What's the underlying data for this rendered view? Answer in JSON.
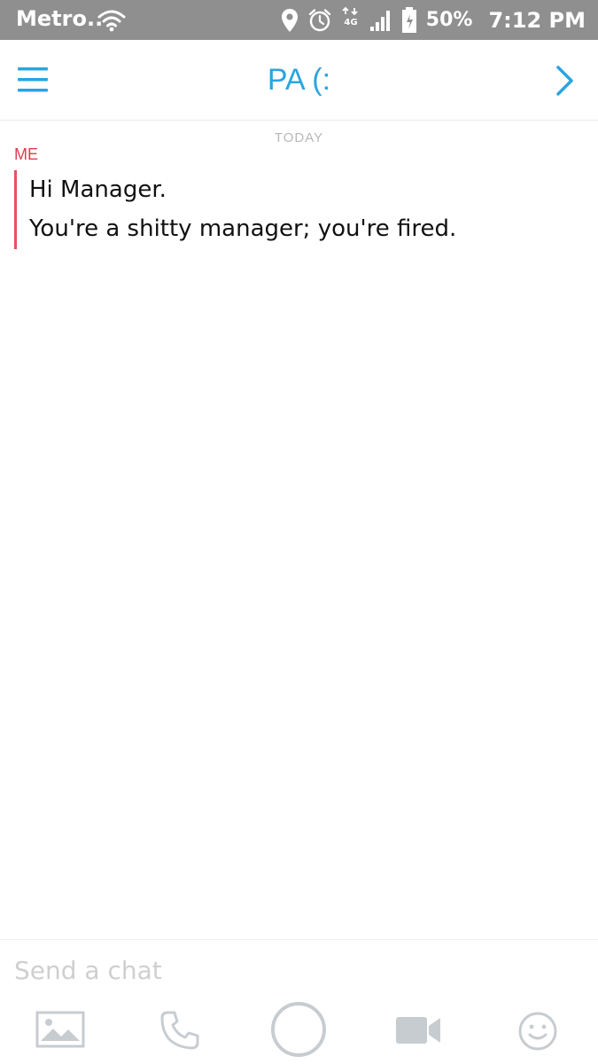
{
  "status_bar": {
    "carrier": "Metro..",
    "battery_percent": "50%",
    "time": "7:12 PM",
    "network_type": "4G",
    "icons": [
      "wifi-icon",
      "location-icon",
      "alarm-icon",
      "network-4g-icon",
      "signal-icon",
      "battery-icon"
    ]
  },
  "header": {
    "title": "PA (:",
    "left_icon": "menu-icon",
    "right_icon": "chevron-right-icon"
  },
  "chat": {
    "date_label": "TODAY",
    "groups": [
      {
        "sender": "ME",
        "messages": [
          "Hi Manager.",
          "You're a shitty manager; you're fired."
        ]
      }
    ]
  },
  "input": {
    "placeholder": "Send a chat",
    "value": ""
  },
  "toolbar": {
    "buttons": [
      "gallery-icon",
      "phone-icon",
      "capture-icon",
      "video-icon",
      "emoji-icon"
    ]
  },
  "colors": {
    "status_bar_bg": "#8f8f8f",
    "accent_blue": "#2aa5df",
    "sender_red": "#e03b4f",
    "message_bar_red": "#e5525f",
    "icon_gray": "#c7ccd1",
    "placeholder_gray": "#cfcfcf"
  }
}
